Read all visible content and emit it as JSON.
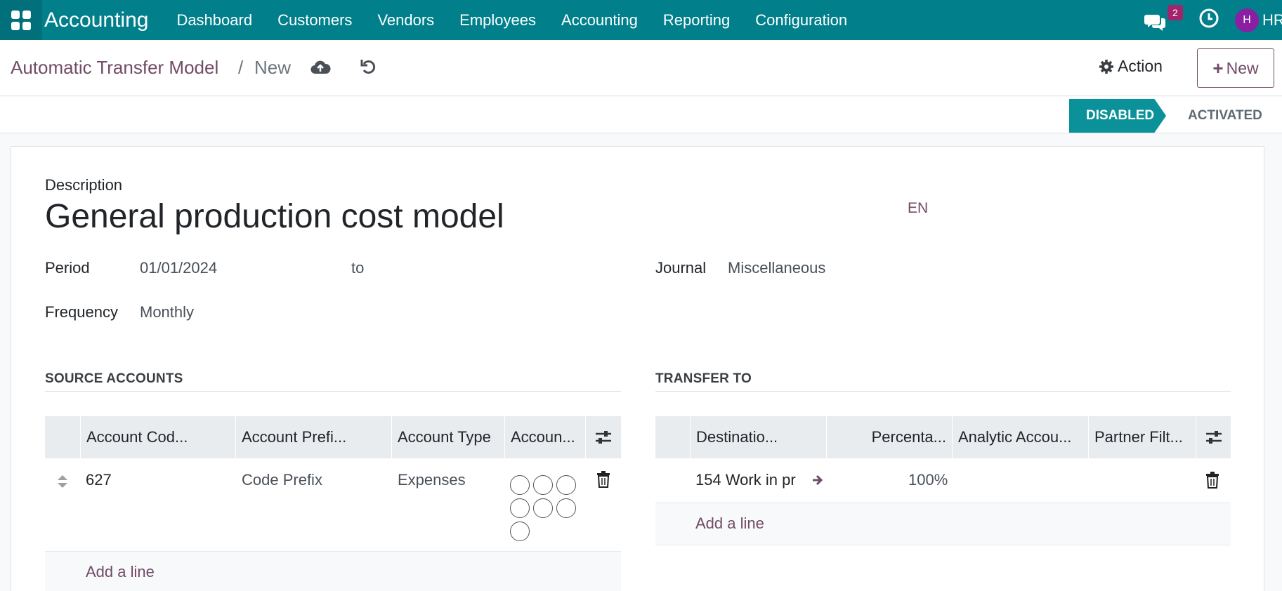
{
  "navbar": {
    "brand": "Accounting",
    "menu": [
      "Dashboard",
      "Customers",
      "Vendors",
      "Employees",
      "Accounting",
      "Reporting",
      "Configuration"
    ],
    "chat_badge": "2",
    "avatar_initial": "H",
    "user_short": "HR"
  },
  "breadcrumb": {
    "parent": "Automatic Transfer Model",
    "separator": "/",
    "current": "New"
  },
  "controls": {
    "action_label": "Action",
    "new_label": "New"
  },
  "status": {
    "stages": [
      "DISABLED",
      "ACTIVATED"
    ],
    "active": "DISABLED"
  },
  "form": {
    "description_label": "Description",
    "description_value": "General production cost model",
    "language": "EN",
    "period_label": "Period",
    "period_start": "01/01/2024",
    "period_to": "to",
    "frequency_label": "Frequency",
    "frequency_value": "Monthly",
    "journal_label": "Journal",
    "journal_value": "Miscellaneous"
  },
  "source_accounts": {
    "title": "SOURCE ACCOUNTS",
    "columns": [
      "Account Cod...",
      "Account Prefi...",
      "Account Type",
      "Accoun..."
    ],
    "rows": [
      {
        "code": "627",
        "prefix": "Code Prefix",
        "type": "Expenses"
      }
    ],
    "add_line": "Add a line"
  },
  "transfer_to": {
    "title": "TRANSFER TO",
    "columns": [
      "Destinatio...",
      "Percenta...",
      "Analytic Accou...",
      "Partner Filt..."
    ],
    "rows": [
      {
        "destination": "154 Work in pr",
        "percentage": "100%"
      }
    ],
    "add_line": "Add a line"
  },
  "colors": {
    "navbar": "#01808c",
    "accent": "#714b67",
    "stage_active": "#0a9199"
  }
}
